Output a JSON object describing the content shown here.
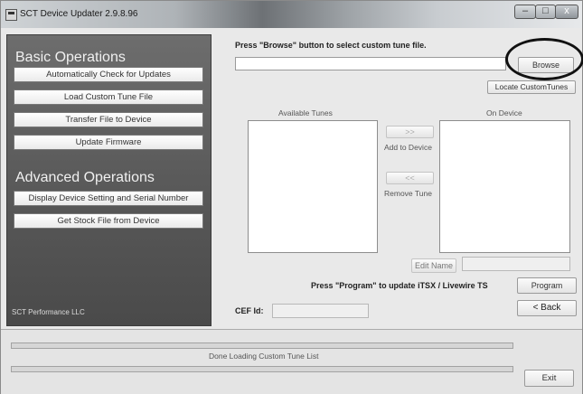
{
  "window": {
    "title": "SCT Device Updater 2.9.8.96",
    "icon": "app-icon",
    "controls": {
      "minimize": "–",
      "maximize": "□",
      "close": "x"
    }
  },
  "sidebar": {
    "basic_title": "Basic Operations",
    "basic_buttons": [
      "Automatically Check for Updates",
      "Load Custom Tune File",
      "Transfer File to Device",
      "Update Firmware"
    ],
    "advanced_title": "Advanced Operations",
    "advanced_buttons": [
      "Display Device Setting and Serial Number",
      "Get Stock File from Device"
    ],
    "brand": "SCT Performance LLC"
  },
  "main": {
    "instruction": "Press \"Browse\" button to select custom tune file.",
    "file_path": "",
    "browse_label": "Browse",
    "locate_label": "Locate CustomTunes",
    "available_label": "Available Tunes",
    "on_device_label": "On Device",
    "add_arrow": ">>",
    "add_label": "Add to Device",
    "remove_arrow": "<<",
    "remove_label": "Remove Tune",
    "edit_name_label": "Edit Name",
    "program_instruction": "Press \"Program\" to update iTSX / Livewire TS",
    "program_label": "Program",
    "back_label": "< Back",
    "cef_label": "CEF Id:",
    "cef_value": ""
  },
  "status": {
    "message": "Done Loading Custom Tune List",
    "exit_label": "Exit"
  }
}
